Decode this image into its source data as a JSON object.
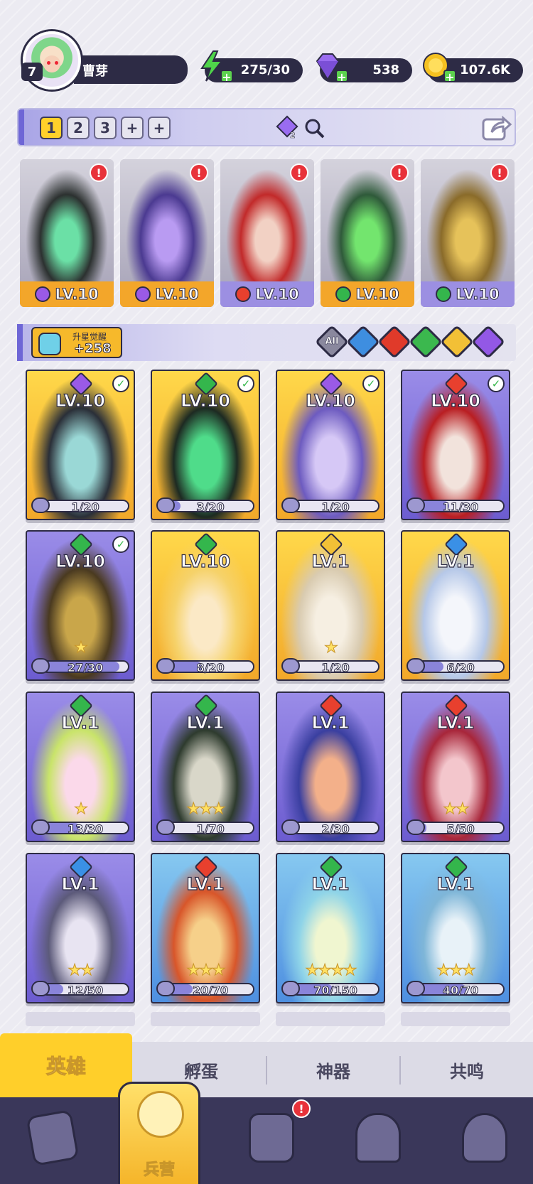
{
  "player": {
    "level": "7",
    "name": "曹芽"
  },
  "resources": [
    {
      "name": "energy",
      "value": "275/30",
      "icon": "lightning-icon",
      "color": "#4fd54a"
    },
    {
      "name": "gems",
      "value": "538",
      "icon": "diamond-icon",
      "color": "#9a6cf0"
    },
    {
      "name": "coins",
      "value": "107.6K",
      "icon": "coin-icon",
      "color": "#f5c120"
    }
  ],
  "team_tabs": [
    "1",
    "2",
    "3",
    "+",
    "+"
  ],
  "team_icons": {
    "swap_badge": "2"
  },
  "team": [
    {
      "level": "LV.10",
      "element": "dark",
      "bar_color": "#f3a62a",
      "alert": "!",
      "art": [
        "#2c3130",
        "#6be0a6"
      ]
    },
    {
      "level": "LV.10",
      "element": "dark",
      "bar_color": "#f3a62a",
      "alert": "!",
      "art": [
        "#4b3a91",
        "#b99bf2"
      ]
    },
    {
      "level": "LV.10",
      "element": "fire",
      "bar_color": "#9c8fe2",
      "alert": "!",
      "art": [
        "#c22a2a",
        "#f2d1c4"
      ]
    },
    {
      "level": "LV.10",
      "element": "nature",
      "bar_color": "#f3a62a",
      "alert": "!",
      "art": [
        "#2f5a3a",
        "#73e56e"
      ]
    },
    {
      "level": "LV.10",
      "element": "nature",
      "bar_color": "#9c8fe2",
      "alert": "!",
      "art": [
        "#8a6b2a",
        "#e6c25a"
      ]
    }
  ],
  "awaken": {
    "label": "升星觉醒",
    "value": "+258"
  },
  "filters": [
    {
      "label": "All",
      "color": "#8a889e"
    },
    {
      "label": "",
      "color": "#3e8ee0"
    },
    {
      "label": "",
      "color": "#e03a2a"
    },
    {
      "label": "",
      "color": "#3bb84e"
    },
    {
      "label": "",
      "color": "#f2c036"
    },
    {
      "label": "",
      "color": "#9358e6"
    }
  ],
  "element_colors": {
    "dark": "#9a5ae6",
    "fire": "#e8402e",
    "nature": "#34b64c",
    "water": "#3a90e6",
    "light": "#f2c036"
  },
  "heroes": [
    {
      "level": "LV.10",
      "element": "dark",
      "frame": "gold",
      "check": true,
      "progress": "1/20",
      "fraction": 0.05,
      "stars": "",
      "art": [
        "#2a2f38",
        "#9ad8d6"
      ]
    },
    {
      "level": "LV.10",
      "element": "nature",
      "frame": "gold",
      "check": true,
      "progress": "3/20",
      "fraction": 0.15,
      "stars": "",
      "art": [
        "#1d2a22",
        "#4fdc8a"
      ]
    },
    {
      "level": "LV.10",
      "element": "dark",
      "frame": "gold",
      "check": true,
      "progress": "1/20",
      "fraction": 0.05,
      "stars": "",
      "art": [
        "#6d5bc0",
        "#d6c8f6"
      ]
    },
    {
      "level": "LV.10",
      "element": "fire",
      "frame": "purple",
      "check": true,
      "progress": "11/30",
      "fraction": 0.37,
      "stars": "",
      "art": [
        "#b91e22",
        "#f2e3dc"
      ]
    },
    {
      "level": "LV.10",
      "element": "nature",
      "frame": "purple",
      "check": true,
      "progress": "27/30",
      "fraction": 0.9,
      "stars": "★",
      "art": [
        "#4a3a20",
        "#c9a64a"
      ]
    },
    {
      "level": "LV.10",
      "element": "nature",
      "frame": "gold",
      "check": false,
      "progress": "8/20",
      "fraction": 0.4,
      "stars": "",
      "art": [
        "#f6d26a",
        "#fbe9c6"
      ]
    },
    {
      "level": "LV.1",
      "element": "light",
      "frame": "gold",
      "check": false,
      "progress": "1/20",
      "fraction": 0.05,
      "stars": "★",
      "art": [
        "#d9cbb0",
        "#f6efe2"
      ]
    },
    {
      "level": "LV.1",
      "element": "water",
      "frame": "gold",
      "check": false,
      "progress": "6/20",
      "fraction": 0.3,
      "stars": "",
      "art": [
        "#b6c8e8",
        "#f4f6fb"
      ]
    },
    {
      "level": "LV.1",
      "element": "nature",
      "frame": "purple",
      "check": false,
      "progress": "13/30",
      "fraction": 0.43,
      "stars": "★",
      "art": [
        "#c9e46a",
        "#fbd9ea"
      ]
    },
    {
      "level": "LV.1",
      "element": "nature",
      "frame": "purple",
      "check": false,
      "progress": "1/70",
      "fraction": 0.01,
      "stars": "★★★",
      "art": [
        "#2e3b2e",
        "#d9d7c9"
      ]
    },
    {
      "level": "LV.1",
      "element": "fire",
      "frame": "purple",
      "check": false,
      "progress": "2/30",
      "fraction": 0.07,
      "stars": "",
      "art": [
        "#3a3fa0",
        "#f3b08a"
      ]
    },
    {
      "level": "LV.1",
      "element": "fire",
      "frame": "purple",
      "check": false,
      "progress": "5/50",
      "fraction": 0.1,
      "stars": "★★",
      "art": [
        "#a8263a",
        "#f3c6cc"
      ]
    },
    {
      "level": "LV.1",
      "element": "water",
      "frame": "purple",
      "check": false,
      "progress": "12/50",
      "fraction": 0.24,
      "stars": "★★",
      "art": [
        "#5c5a7a",
        "#e8e4f2"
      ]
    },
    {
      "level": "LV.1",
      "element": "fire",
      "frame": "blue",
      "check": false,
      "progress": "20/70",
      "fraction": 0.29,
      "stars": "★★★",
      "art": [
        "#d8562a",
        "#f6d08a"
      ]
    },
    {
      "level": "LV.1",
      "element": "nature",
      "frame": "blue",
      "check": false,
      "progress": "70/150",
      "fraction": 0.47,
      "stars": "★★★★",
      "art": [
        "#8fd4e8",
        "#f0f6d0"
      ]
    },
    {
      "level": "LV.1",
      "element": "nature",
      "frame": "blue",
      "check": false,
      "progress": "40/70",
      "fraction": 0.57,
      "stars": "★★★",
      "art": [
        "#7fb6d8",
        "#e8f2f8"
      ]
    }
  ],
  "frame_colors": {
    "gold": [
      "#ffd84a",
      "#f2a82a"
    ],
    "purple": [
      "#9a8ce8",
      "#6c5cd0"
    ],
    "blue": [
      "#86c8f0",
      "#4e8fe0"
    ]
  },
  "subtabs": [
    "英雄",
    "孵蛋",
    "神器",
    "共鸣"
  ],
  "nav": {
    "active_label": "兵营",
    "alert": "!"
  }
}
